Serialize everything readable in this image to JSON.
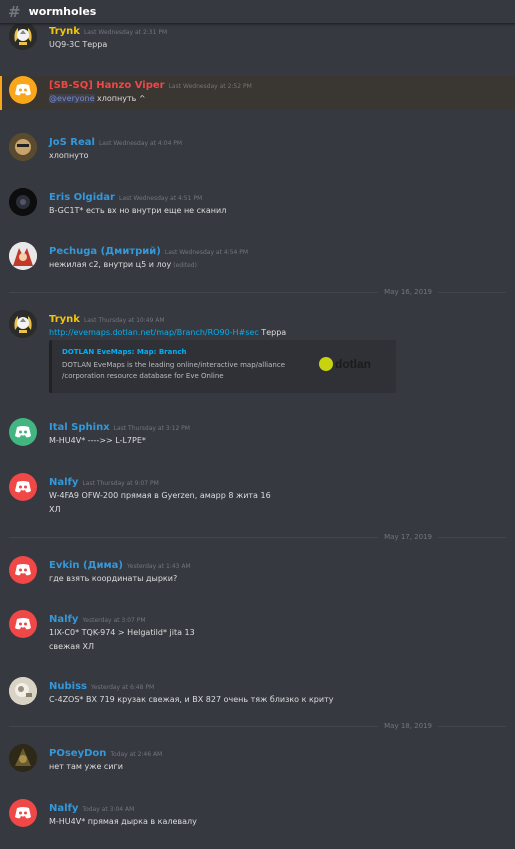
{
  "header": {
    "channel": "wormholes"
  },
  "messages": [
    {
      "user": "Trynk",
      "time": "Last Wednesday at 2:31 PM",
      "lines": [
        "UQ9-3C Терра"
      ]
    },
    {
      "user": "[SB-SQ] Hanzo Viper",
      "time": "Last Wednesday at 2:52 PM",
      "mention": "@everyone",
      "text": " хлопнуть ^"
    },
    {
      "user": "JoS Real",
      "time": "Last Wednesday at 4:04 PM",
      "lines": [
        "хлопнуто"
      ]
    },
    {
      "user": "Eris Olgidar",
      "time": "Last Wednesday at 4:51 PM",
      "lines": [
        "B-GC1T*  есть вх но внутри еще не сканил"
      ]
    },
    {
      "user": "Pechuga (Дмитрий)",
      "time": "Last Wednesday at 4:54 PM",
      "text": "нежилая с2, внутри ц5 и лоу",
      "edited": "(edited)"
    },
    {
      "user": "Trynk",
      "time": "Last Thursday at 10:49 AM",
      "link": "http://evemaps.dotlan.net/map/Branch/RO90-H#sec",
      "text": " Терра"
    },
    {
      "user": "Ital Sphinx",
      "time": "Last Thursday at 3:12 PM",
      "lines": [
        "M-HU4V* ---->>  L-L7PE*"
      ]
    },
    {
      "user": "Nalfy",
      "time": "Last Thursday at 9:07 PM",
      "lines": [
        "W-4FA9 OFW-200 прямая в  Gyerzen, амарр 8 жита 16",
        "ХЛ"
      ]
    },
    {
      "user": "Evkin (Дима)",
      "time": "Yesterday at 1:43 AM",
      "lines": [
        "где взять координаты дырки?"
      ]
    },
    {
      "user": "Nalfy",
      "time": "Yesterday at 3:07 PM",
      "lines": [
        "1IX-C0*  TQK-974 >  Helgatild* jita 13",
        "свежая ХЛ"
      ]
    },
    {
      "user": "Nubiss",
      "time": "Yesterday at 6:48 PM",
      "lines": [
        "C-4ZOS* BX 719 крузак свежая, и BX 827 очень тяж близко к криту"
      ]
    },
    {
      "user": "POseyDon",
      "time": "Today at 2:46 AM",
      "lines": [
        "нет там уже сиги"
      ]
    },
    {
      "user": "Nalfy",
      "time": "Today at 3:04 AM",
      "lines": [
        "M-HU4V*  прямая дырка в калевалу"
      ]
    }
  ],
  "dividers": [
    "May 16, 2019",
    "May 17, 2019",
    "May 18, 2019"
  ],
  "embed": {
    "title": "DOTLAN EveMaps: Map: Branch",
    "description": "DOTLAN EveMaps is the leading online/interactive map/alliance /corporation resource database for Eve Online",
    "logo_text": "dotlan"
  },
  "colors": {
    "trynk": "#f1c40f",
    "hanzo": "#f04747",
    "blue": "#3498db",
    "discord_orange": "#faa61a",
    "discord_green": "#43b581",
    "discord_red": "#f04747"
  }
}
